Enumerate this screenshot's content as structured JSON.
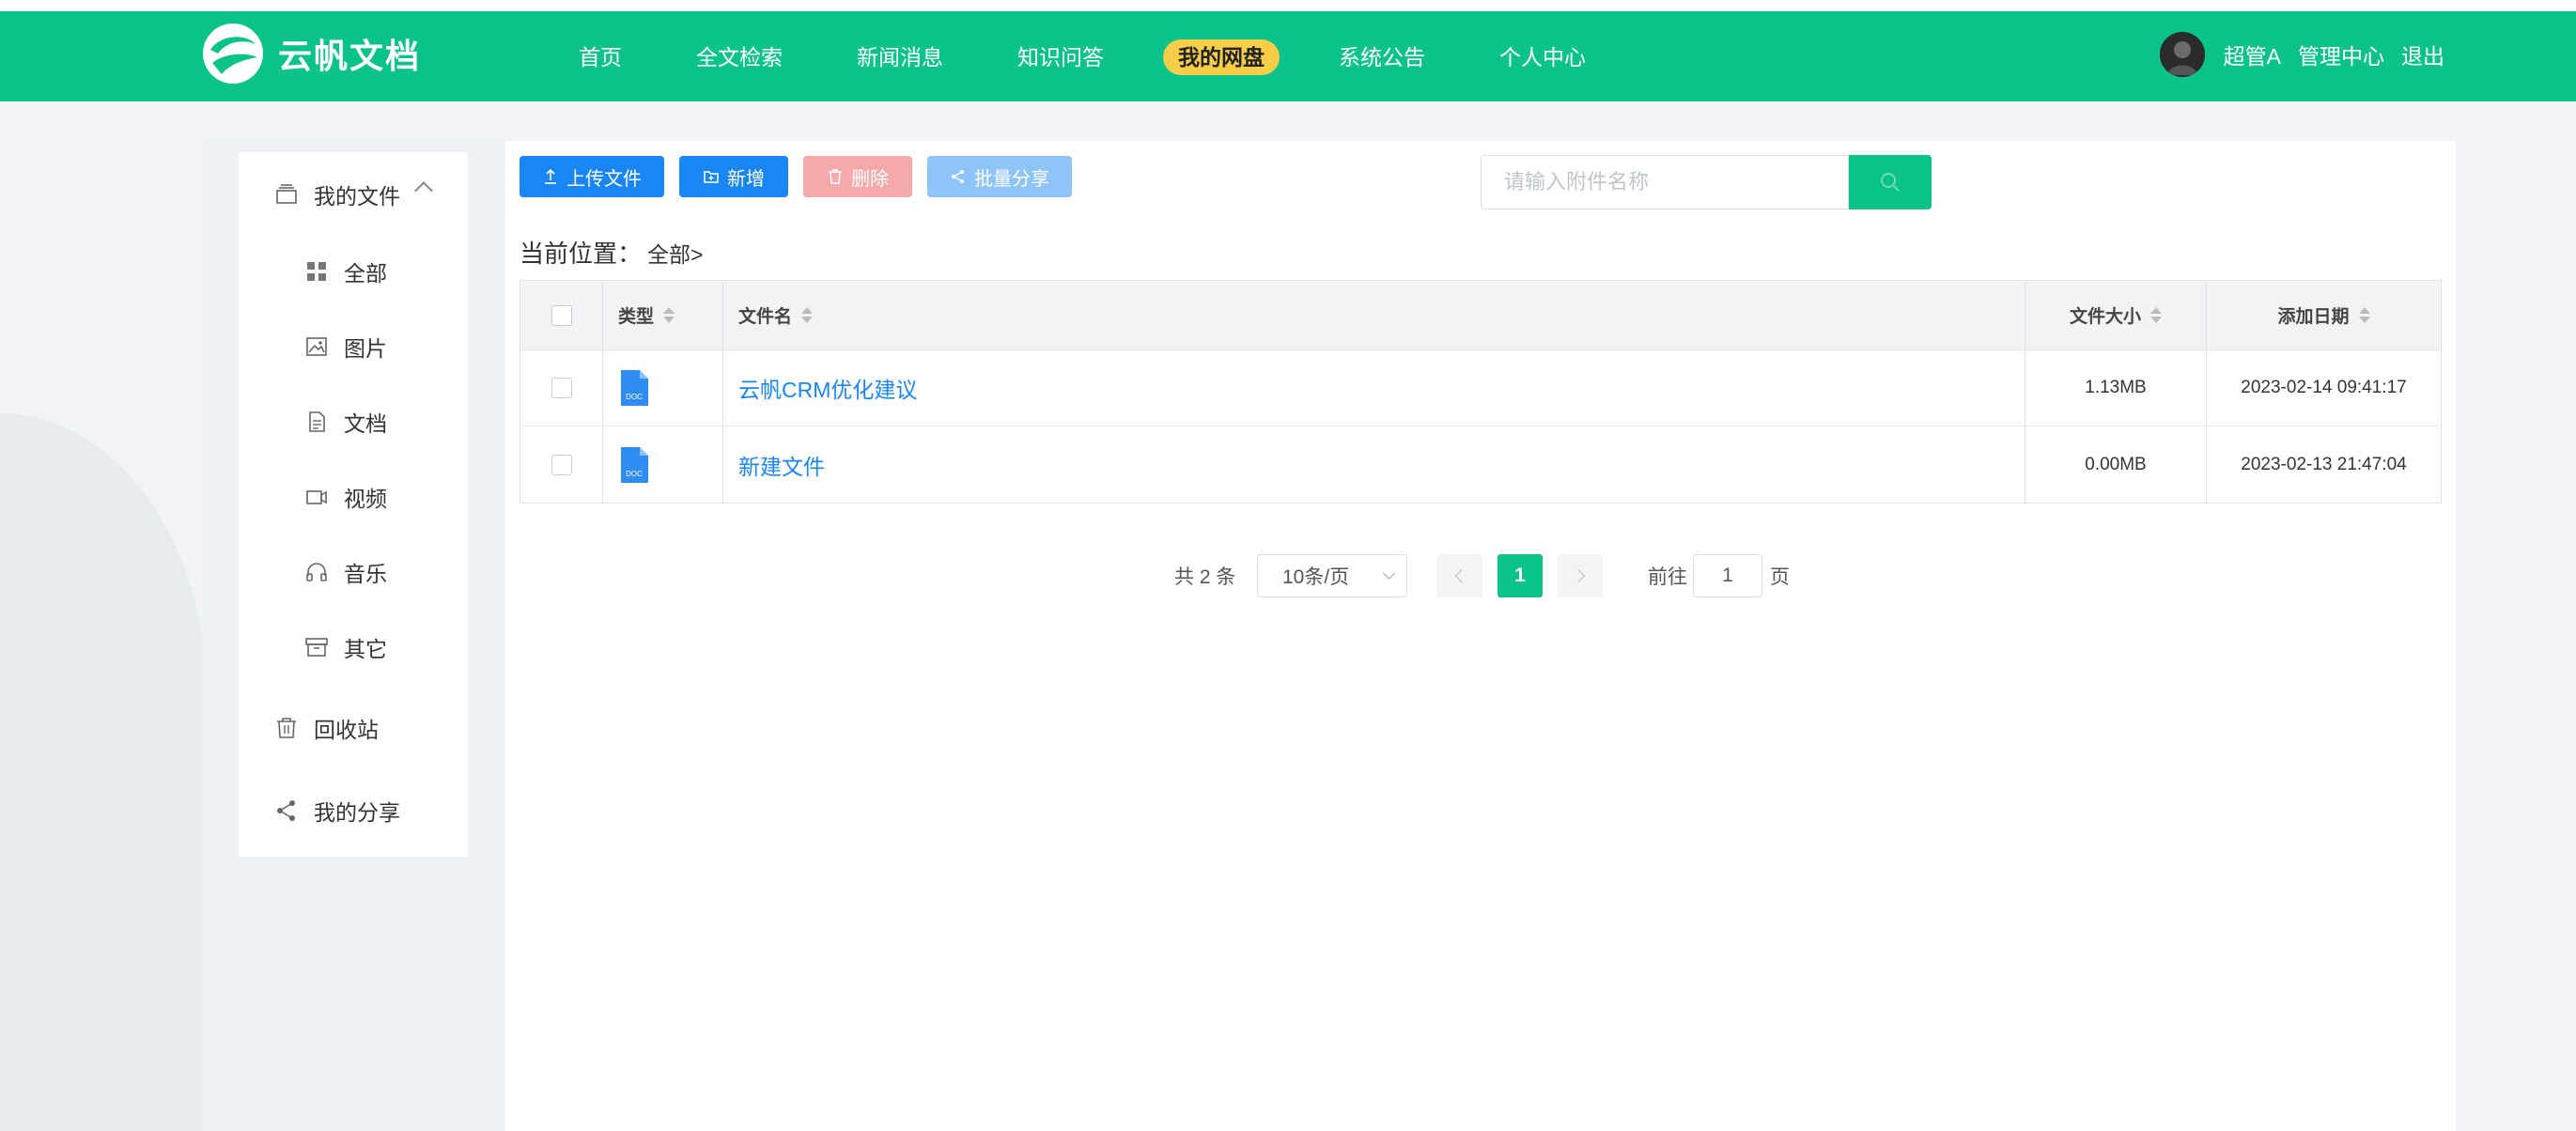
{
  "header": {
    "logo_text": "云帆文档",
    "nav": [
      {
        "label": "首页",
        "active": false
      },
      {
        "label": "全文检索",
        "active": false
      },
      {
        "label": "新闻消息",
        "active": false
      },
      {
        "label": "知识问答",
        "active": false
      },
      {
        "label": "我的网盘",
        "active": true
      },
      {
        "label": "系统公告",
        "active": false
      },
      {
        "label": "个人中心",
        "active": false
      }
    ],
    "user_name": "超管A",
    "admin_link": "管理中心",
    "logout_link": "退出"
  },
  "sidebar": {
    "my_files": "我的文件",
    "items": [
      {
        "label": "全部",
        "icon": "grid-icon"
      },
      {
        "label": "图片",
        "icon": "image-icon"
      },
      {
        "label": "文档",
        "icon": "document-icon"
      },
      {
        "label": "视频",
        "icon": "video-icon"
      },
      {
        "label": "音乐",
        "icon": "headphones-icon"
      },
      {
        "label": "其它",
        "icon": "archive-icon"
      }
    ],
    "recycle": "回收站",
    "my_share": "我的分享"
  },
  "toolbar": {
    "upload_label": "上传文件",
    "add_label": "新增",
    "delete_label": "删除",
    "share_label": "批量分享",
    "search_placeholder": "请输入附件名称"
  },
  "breadcrumb": {
    "prefix": "当前位置：",
    "current": "全部>"
  },
  "table": {
    "headers": {
      "type": "类型",
      "name": "文件名",
      "size": "文件大小",
      "date": "添加日期"
    },
    "rows": [
      {
        "type_icon": "DOC",
        "name": "云帆CRM优化建议",
        "size": "1.13MB",
        "date": "2023-02-14 09:41:17"
      },
      {
        "type_icon": "DOC",
        "name": "新建文件",
        "size": "0.00MB",
        "date": "2023-02-13 21:47:04"
      }
    ]
  },
  "pagination": {
    "total": "共 2 条",
    "page_size": "10条/页",
    "current_page": "1",
    "goto_label": "前往",
    "goto_value": "1",
    "page_suffix": "页"
  },
  "colors": {
    "brand": "#0ac28a",
    "primary_button": "#1a86f5",
    "active_nav": "#f8cd47",
    "link": "#1a86f5"
  }
}
